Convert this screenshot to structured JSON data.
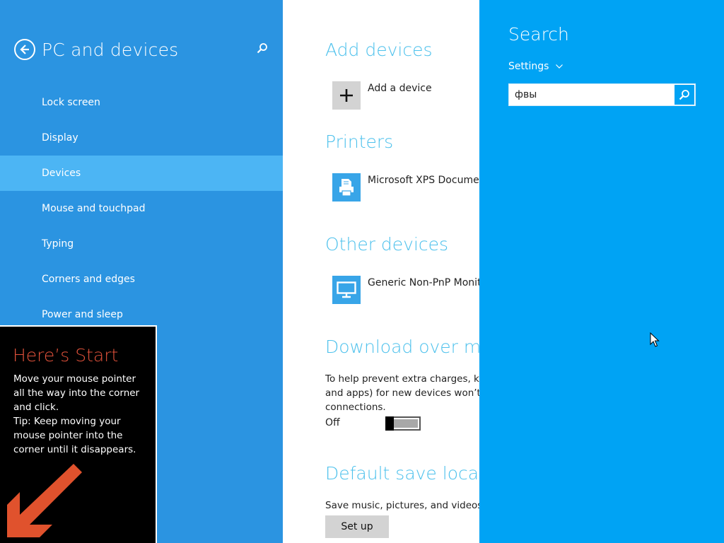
{
  "nav": {
    "title": "PC and devices",
    "back_icon": "back-arrow-icon",
    "search_icon": "search-icon",
    "items": [
      {
        "label": "Lock screen"
      },
      {
        "label": "Display"
      },
      {
        "label": "Devices",
        "active": true
      },
      {
        "label": "Mouse and touchpad"
      },
      {
        "label": "Typing"
      },
      {
        "label": "Corners and edges"
      },
      {
        "label": "Power and sleep"
      }
    ]
  },
  "content": {
    "add_devices": {
      "title": "Add devices",
      "item_label": "Add a device"
    },
    "printers": {
      "title": "Printers",
      "item_label": "Microsoft XPS Document"
    },
    "other_devices": {
      "title": "Other devices",
      "item_label": "Generic Non-PnP Monito"
    },
    "download": {
      "title": "Download over met",
      "lines": [
        "To help prevent extra charges, keep",
        "and apps) for new devices won’t do",
        "connections."
      ],
      "toggle_label": "Off",
      "toggle_on": false
    },
    "default_save": {
      "title": "Default save locatio",
      "text": "Save music, pictures, and videos to",
      "button_label": "Set up"
    }
  },
  "charm": {
    "title": "Search",
    "scope": "Settings",
    "query": "фвы"
  },
  "start_tip": {
    "title": "Here’s Start",
    "body_lines": [
      "Move your mouse pointer",
      "all the way into the corner",
      "and click.",
      "Tip: Keep moving your",
      "mouse pointer into the",
      "corner until it disappears."
    ]
  },
  "colors": {
    "nav_bg": "#2b94e1",
    "nav_active": "#4cb5f4",
    "charm_bg": "#00a3f4",
    "accent_title": "#4dc1ec",
    "tip_title": "#e2523b",
    "tip_arrow": "#e0522d"
  }
}
